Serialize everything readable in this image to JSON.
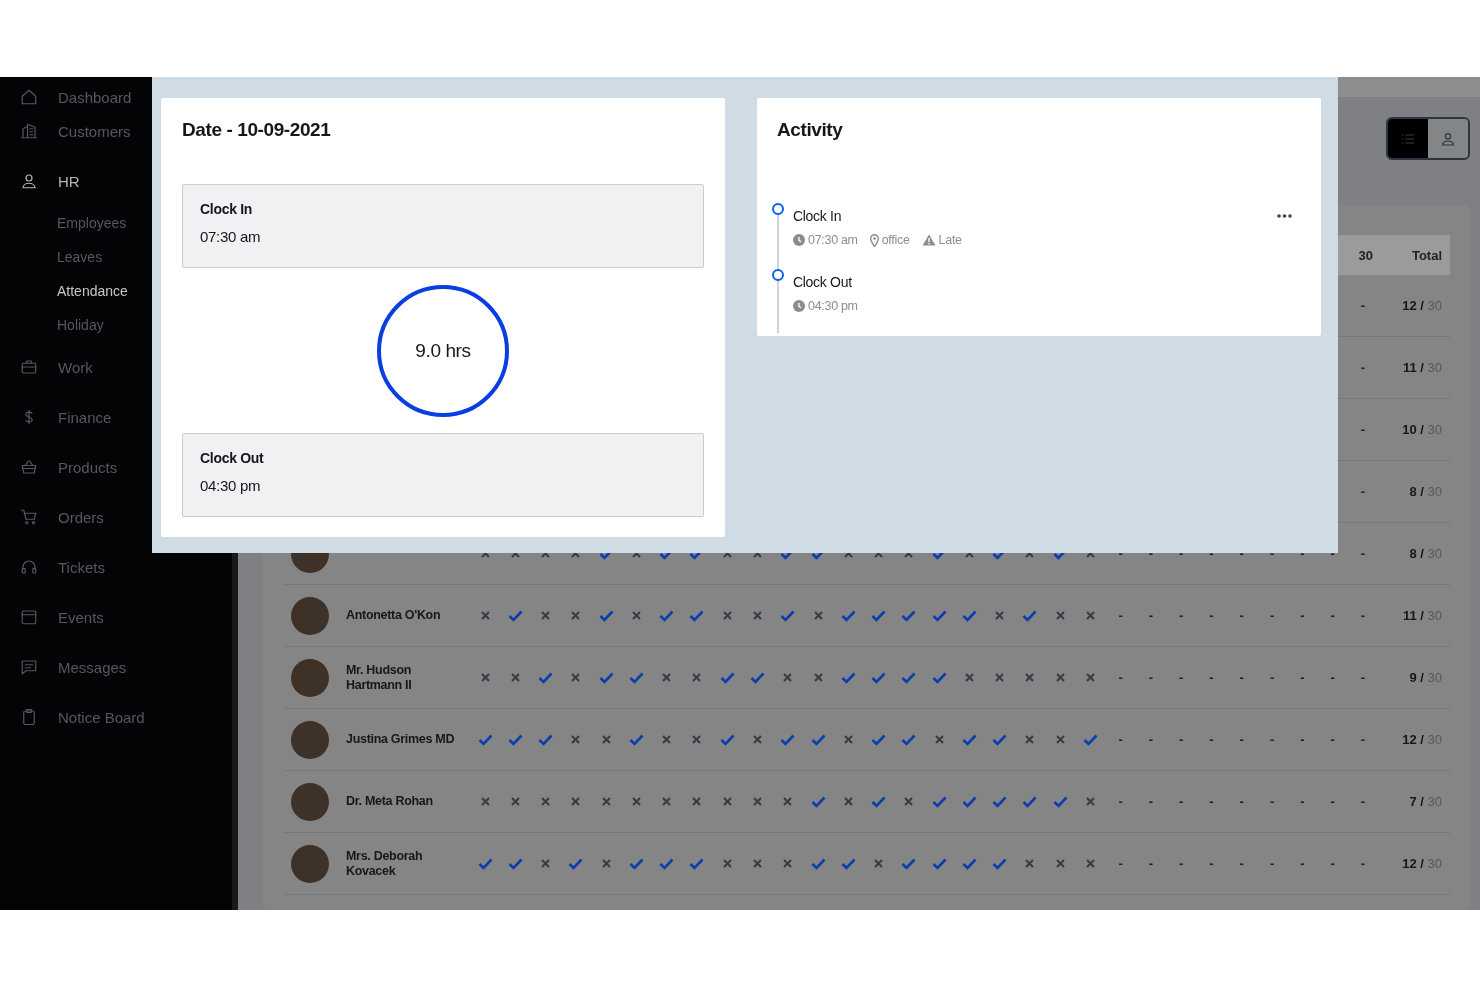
{
  "sidebar": {
    "items": [
      {
        "label": "Dashboard",
        "kind": "home",
        "expanded": false
      },
      {
        "label": "Customers",
        "kind": "building",
        "expanded": false
      },
      {
        "label": "HR",
        "kind": "person",
        "expanded": true,
        "children": [
          {
            "label": "Employees",
            "selected": false
          },
          {
            "label": "Leaves",
            "selected": false
          },
          {
            "label": "Attendance",
            "selected": true
          },
          {
            "label": "Holiday",
            "selected": false
          }
        ]
      },
      {
        "label": "Work",
        "kind": "briefcase",
        "expanded": false
      },
      {
        "label": "Finance",
        "kind": "dollar",
        "expanded": false
      },
      {
        "label": "Products",
        "kind": "basket",
        "expanded": false
      },
      {
        "label": "Orders",
        "kind": "cart",
        "expanded": false
      },
      {
        "label": "Tickets",
        "kind": "headset",
        "expanded": false
      },
      {
        "label": "Events",
        "kind": "calendar",
        "expanded": false
      },
      {
        "label": "Messages",
        "kind": "chat",
        "expanded": false
      },
      {
        "label": "Notice Board",
        "kind": "clipboard",
        "expanded": false
      }
    ]
  },
  "view_toggle": [
    {
      "kind": "list",
      "selected": true
    },
    {
      "kind": "person",
      "selected": false
    }
  ],
  "table": {
    "columns": [
      "30"
    ],
    "total_column": "Total",
    "rows": [
      {
        "present": [
          "-"
        ],
        "total": "**12 /** 30"
      },
      {
        "present": [
          "-"
        ],
        "total": "**11 /** 30"
      },
      {
        "present": [
          "-"
        ],
        "total": "**10 /** 30"
      },
      {
        "present": [
          "-"
        ],
        "total": "**8 /** 30"
      },
      {
        "avatar": true,
        "present": [
          false,
          false,
          false,
          false,
          true,
          false,
          true,
          true,
          false,
          false,
          true,
          true,
          false,
          false,
          false,
          true,
          false,
          true,
          false,
          true,
          false,
          "-",
          "-",
          "-",
          "-",
          "-",
          "-",
          "-",
          "-",
          "-"
        ],
        "total": "**8 /** 30"
      },
      {
        "avatar": true,
        "name": "Antonetta O'Kon",
        "present": [
          false,
          true,
          false,
          false,
          true,
          false,
          true,
          true,
          false,
          false,
          true,
          false,
          true,
          true,
          true,
          true,
          true,
          false,
          true,
          false,
          false,
          "-",
          "-",
          "-",
          "-",
          "-",
          "-",
          "-",
          "-",
          "-"
        ],
        "total": "**11 /** 30"
      },
      {
        "avatar": true,
        "name": "Mr. Hudson Hartmann II",
        "present": [
          false,
          false,
          true,
          false,
          true,
          true,
          false,
          false,
          true,
          true,
          false,
          false,
          true,
          true,
          true,
          true,
          false,
          false,
          false,
          false,
          false,
          "-",
          "-",
          "-",
          "-",
          "-",
          "-",
          "-",
          "-",
          "-"
        ],
        "total": "**9 /** 30"
      },
      {
        "avatar": true,
        "name": "Justina Grimes MD",
        "present": [
          true,
          true,
          true,
          false,
          false,
          true,
          false,
          false,
          true,
          false,
          true,
          true,
          false,
          true,
          true,
          false,
          true,
          true,
          false,
          false,
          true,
          "-",
          "-",
          "-",
          "-",
          "-",
          "-",
          "-",
          "-",
          "-"
        ],
        "total": "**12 /** 30"
      },
      {
        "avatar": true,
        "name": "Dr. Meta Rohan",
        "present": [
          false,
          false,
          false,
          false,
          false,
          false,
          false,
          false,
          false,
          false,
          false,
          true,
          false,
          true,
          false,
          true,
          true,
          true,
          true,
          true,
          false,
          "-",
          "-",
          "-",
          "-",
          "-",
          "-",
          "-",
          "-",
          "-"
        ],
        "total": "**7 /** 30"
      },
      {
        "avatar": true,
        "name": "Mrs. Deborah Kovacek",
        "present": [
          true,
          true,
          false,
          true,
          false,
          true,
          true,
          true,
          false,
          false,
          false,
          true,
          true,
          false,
          true,
          true,
          true,
          true,
          false,
          false,
          false,
          "-",
          "-",
          "-",
          "-",
          "-",
          "-",
          "-",
          "-",
          "-"
        ],
        "total": "**12 /** 30"
      }
    ]
  },
  "attendance_modal": {
    "date_title": "Date - 10-09-2021",
    "clock_in": {
      "label": "Clock In",
      "time": "07:30 am"
    },
    "duration": "9.0 hrs",
    "clock_out": {
      "label": "Clock Out",
      "time": "04:30 pm"
    },
    "activity": {
      "title": "Activity",
      "items": [
        {
          "title": "Clock In",
          "has_menu": true,
          "meta": [
            {
              "kind": "time",
              "text": "07:30 am"
            },
            {
              "kind": "location",
              "text": "office"
            },
            {
              "kind": "warning",
              "text": "Late"
            }
          ]
        },
        {
          "title": "Clock Out",
          "has_menu": false,
          "meta": [
            {
              "kind": "time",
              "text": "04:30 pm"
            }
          ]
        }
      ]
    }
  }
}
